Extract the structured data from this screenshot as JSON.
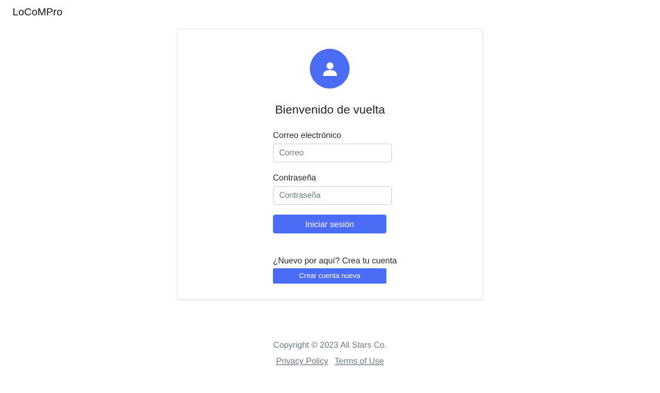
{
  "brand": "LoCoMPro",
  "login": {
    "avatar_icon": "user-icon",
    "title": "Bienvenido de vuelta",
    "email_label": "Correo electrónico",
    "email_placeholder": "Correo",
    "email_value": "",
    "password_label": "Contraseña",
    "password_placeholder": "Contraseña",
    "password_value": "",
    "submit_label": "Iniciar sesión",
    "register_prompt": "¿Nuevo por aquí? Crea tu cuenta",
    "register_label": "Crear cuenta nueva"
  },
  "footer": {
    "copyright": "Copyright © 2023 All Stars Co.",
    "privacy": "Privacy Policy",
    "terms": "Terms of Use"
  },
  "colors": {
    "accent": "#4b6cf6",
    "muted_text": "#6c757d"
  }
}
